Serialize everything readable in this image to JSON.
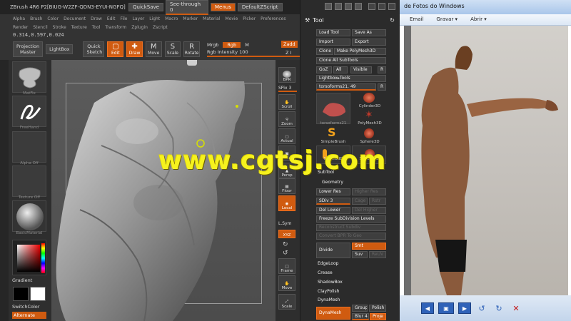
{
  "zbrush": {
    "title": "ZBrush 4R6 P2[BIUG-W2ZF-QDN3-EYUI-NGFQ]",
    "quicksave": "QuickSave",
    "see_through": "See-through  0",
    "menus": "Menus",
    "default_zscript": "DefaultZScript",
    "menu_row1": [
      "Alpha",
      "Brush",
      "Color",
      "Document",
      "Draw",
      "Edit",
      "File",
      "Layer",
      "Light",
      "Macro",
      "Marker",
      "Material",
      "Movie",
      "Picker",
      "Preferences"
    ],
    "menu_row2": [
      "Render",
      "Stencil",
      "Stroke",
      "Texture",
      "Tool",
      "Transform",
      "Zplugin",
      "Zscript"
    ],
    "coords": "0.314,0.597,0.024",
    "shelf": {
      "projection_master": "Projection Master",
      "lightbox": "LightBox",
      "quick_sketch": "Quick Sketch",
      "edit": "Edit",
      "draw": "Draw",
      "move": "Move",
      "scale": "Scale",
      "rotate": "Rotate",
      "mrgb": "Mrgb",
      "rgb": "Rgb",
      "m": "M",
      "rgb_intensity": "Rgb Intensity 100",
      "zadd": "Zadd",
      "zsub": "Z I"
    },
    "left_tray": {
      "brush_label": "MatFix",
      "stroke_label": "FreeHand",
      "alpha_label": "Alpha Off",
      "texture_label": "Texture Off",
      "material_label": "BasicMaterial",
      "gradient": "Gradient",
      "switch_color": "SwitchColor",
      "alternate": "Alternate"
    },
    "right_shelf": {
      "bpr": "BPR",
      "spix": "SPix",
      "spix_value": "3",
      "scroll": "Scroll",
      "zoom": "Zoom",
      "actual": "Actual",
      "aahalf": "AAHalf",
      "persp": "Persp",
      "floor": "Floor",
      "local": "Local",
      "lsym": "L.Sym",
      "xyz": "XYZ",
      "frame": "Frame",
      "move": "Move",
      "scale": "Scale"
    },
    "tool": {
      "title": "Tool",
      "load_tool": "Load Tool",
      "save_as": "Save As",
      "import": "Import",
      "export": "Export",
      "clone": "Clone",
      "make_polymesh": "Make PolyMesh3D",
      "clone_all": "Clone All SubTools",
      "goz": "GoZ",
      "all": "All",
      "visible": "Visible",
      "r": "R",
      "lightbox_tools": "Lightbox▸Tools",
      "current_tool": "torsoforms21. 49",
      "r2": "R",
      "thumbs": {
        "torso": "torsoforms21",
        "cylinder": "Cylinder3D",
        "polymesh": "PolyMesh3D",
        "simplebrush": "SimpleBrush",
        "sphere": "Sphere3D",
        "sphere_left": "Sphere3D",
        "sphere_left2": "Sphere3D",
        "sphere_right": "Sphere3D"
      },
      "subtool": "SubTool",
      "geometry": "Geometry",
      "lower_res": "Lower Res",
      "higher_res": "Higher Res",
      "sdiv": "SDiv 3",
      "cage": "Cage",
      "rstr": "Rstr",
      "del_lower": "Del Lower",
      "del_higher": "Del Higher",
      "freeze": "Freeze SubDivision Levels",
      "reconstruct": "Reconstruct Subdiv",
      "convert_bpr": "Convert BPR To Geo",
      "divide": "Divide",
      "smt": "Smt",
      "suv": "Suv",
      "reuv": "ReUV",
      "edgeloop": "EdgeLoop",
      "crease": "Crease",
      "shadowbox": "ShadowBox",
      "claypolish": "ClayPolish",
      "dynamesh_title": "DynaMesh",
      "dynamesh": "DynaMesh",
      "group": "Group",
      "polish": "Polish",
      "blur": "Blur",
      "blur_value": "4",
      "proj": "Proje"
    }
  },
  "viewer": {
    "title": "de Fotos do Windows",
    "menu": [
      "Email",
      "Gravar ▾",
      "Abrir ▾"
    ],
    "controls": [
      "prev-icon",
      "slideshow-icon",
      "next-icon",
      "rotate-left-icon",
      "rotate-right-icon",
      "delete-icon"
    ]
  },
  "watermark": "www.cgtsj.com",
  "colors": {
    "accent": "#d05b10",
    "watermark": "#f6f21e",
    "panel": "#2b2b2b"
  }
}
